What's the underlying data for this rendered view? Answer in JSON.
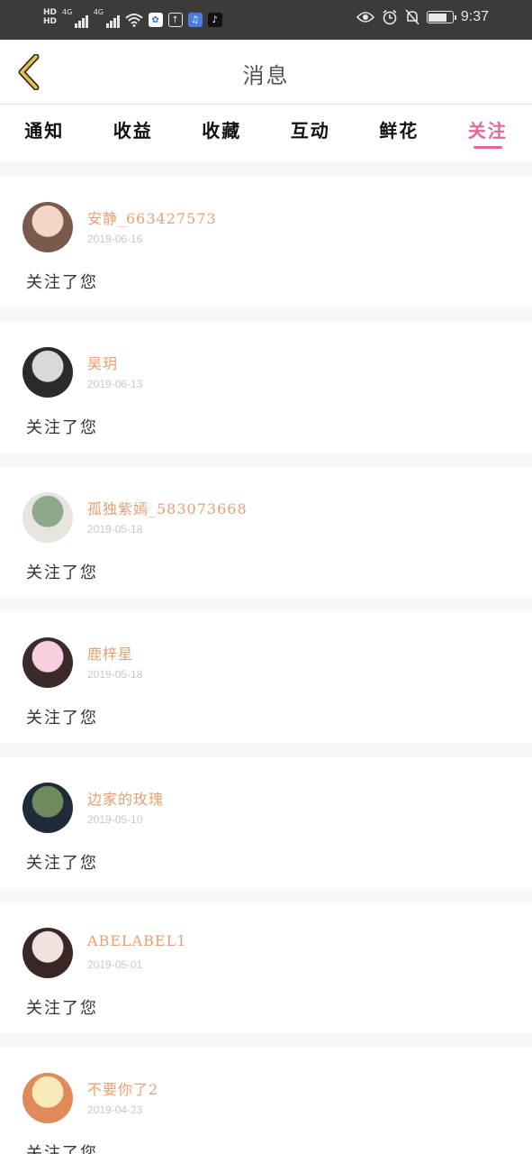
{
  "status_bar": {
    "network_labels": [
      "4G",
      "4G"
    ],
    "time": "9:37",
    "battery_level": 0.8
  },
  "header": {
    "title": "消息",
    "back_icon": "chevron-left-icon"
  },
  "tabs": [
    {
      "label": "通知",
      "active": false
    },
    {
      "label": "收益",
      "active": false
    },
    {
      "label": "收藏",
      "active": false
    },
    {
      "label": "互动",
      "active": false
    },
    {
      "label": "鲜花",
      "active": false
    },
    {
      "label": "关注",
      "active": true
    }
  ],
  "colors": {
    "accent": "#e2679a",
    "username": "#e6a072",
    "date": "#c8c8c8",
    "status_bar": "#3b3b3b",
    "back_icon": "#e8c14a"
  },
  "follows": [
    {
      "name": "安静_663427573",
      "date": "2019-06-16",
      "message": "关注了您",
      "avatar_colors": [
        "#f3d6c8",
        "#7a5a4a"
      ]
    },
    {
      "name": "昊玥",
      "date": "2019-06-13",
      "message": "关注了您",
      "avatar_colors": [
        "#d9d9d9",
        "#2a2a2a"
      ]
    },
    {
      "name": "孤独紫嫣_583073668",
      "date": "2019-05-18",
      "message": "关注了您",
      "avatar_colors": [
        "#8fa88a",
        "#e8e4df"
      ]
    },
    {
      "name": "鹿梓星",
      "date": "2019-05-18",
      "message": "关注了您",
      "avatar_colors": [
        "#f7cfe0",
        "#3a2a2a"
      ]
    },
    {
      "name": "边家的玫瑰",
      "date": "2019-05-10",
      "message": "关注了您",
      "avatar_colors": [
        "#6f8a5c",
        "#1f2a3a"
      ]
    },
    {
      "name": "ABELABEL1",
      "date": "2019-05-01",
      "message": "关注了您",
      "avatar_colors": [
        "#f2e2dd",
        "#3a2626"
      ]
    },
    {
      "name": "不要你了2",
      "date": "2019-04-23",
      "message": "关注了您",
      "avatar_colors": [
        "#f7e9b8",
        "#e0895a"
      ]
    }
  ]
}
